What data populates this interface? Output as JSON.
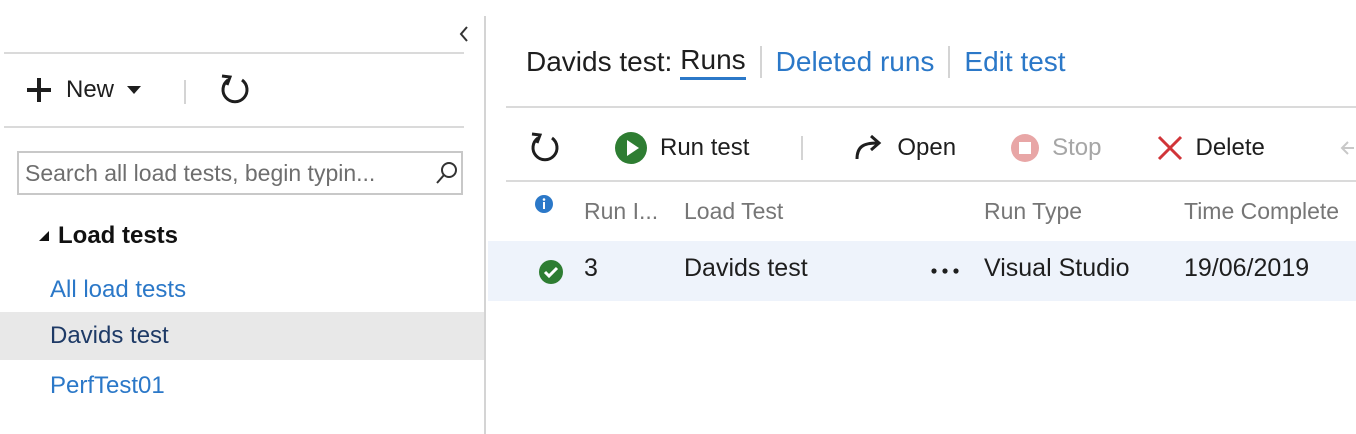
{
  "left_panel": {
    "collapse_icon": "chevron-left-icon",
    "new_label": "New",
    "search_placeholder": "Search all load tests, begin typin...",
    "tree_header": "Load tests",
    "items": [
      {
        "label": "All load tests",
        "selected": false
      },
      {
        "label": "Davids test",
        "selected": true
      },
      {
        "label": "PerfTest01",
        "selected": false
      }
    ]
  },
  "main": {
    "title_prefix": "Davids test:",
    "tabs": [
      {
        "label": "Runs",
        "active": true
      },
      {
        "label": "Deleted runs",
        "active": false
      },
      {
        "label": "Edit test",
        "active": false
      }
    ],
    "toolbar": {
      "run_test": "Run test",
      "open": "Open",
      "stop": "Stop",
      "delete": "Delete"
    },
    "columns": [
      "Run I...",
      "Load Test",
      "Run Type",
      "Time Complete"
    ],
    "rows": [
      {
        "status": "success",
        "run_id": "3",
        "load_test": "Davids test",
        "run_type": "Visual Studio",
        "time_complete": "19/06/2019"
      }
    ]
  },
  "colors": {
    "accent": "#2b78c8",
    "success": "#2e7d32",
    "stop_disabled": "#e8a6a6",
    "delete_red": "#d13438",
    "selected_row": "#eef3fb"
  }
}
